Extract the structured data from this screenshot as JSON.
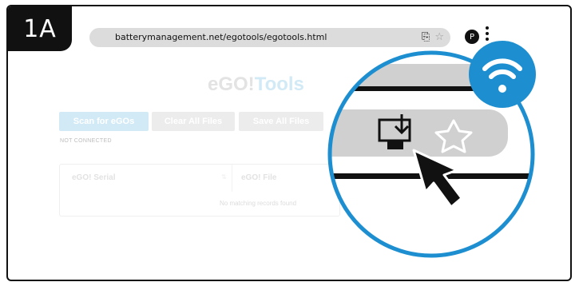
{
  "step": {
    "label": "1A"
  },
  "browser": {
    "url": "batterymanagement.net/egotools/egotools.html",
    "profile_initial": "P",
    "icons": [
      "install-app-icon",
      "bookmark-star-icon",
      "kebab-menu-icon"
    ]
  },
  "app": {
    "brand_ego": "eGO!",
    "brand_tools": "Tools",
    "buttons": {
      "scan": "Scan for eGOs",
      "clear": "Clear All Files",
      "save": "Save All Files"
    },
    "status": "NOT CONNECTED",
    "table": {
      "columns": [
        "eGO! Serial",
        "eGO! File"
      ],
      "empty_message": "No matching records found"
    }
  },
  "callout": {
    "icons": [
      "install-app-icon",
      "bookmark-star-icon",
      "mouse-pointer-icon",
      "wifi-icon"
    ]
  },
  "colors": {
    "accent_light_blue": "#d2eaf6",
    "callout_blue": "#1d8fd1",
    "dark": "#111111"
  }
}
